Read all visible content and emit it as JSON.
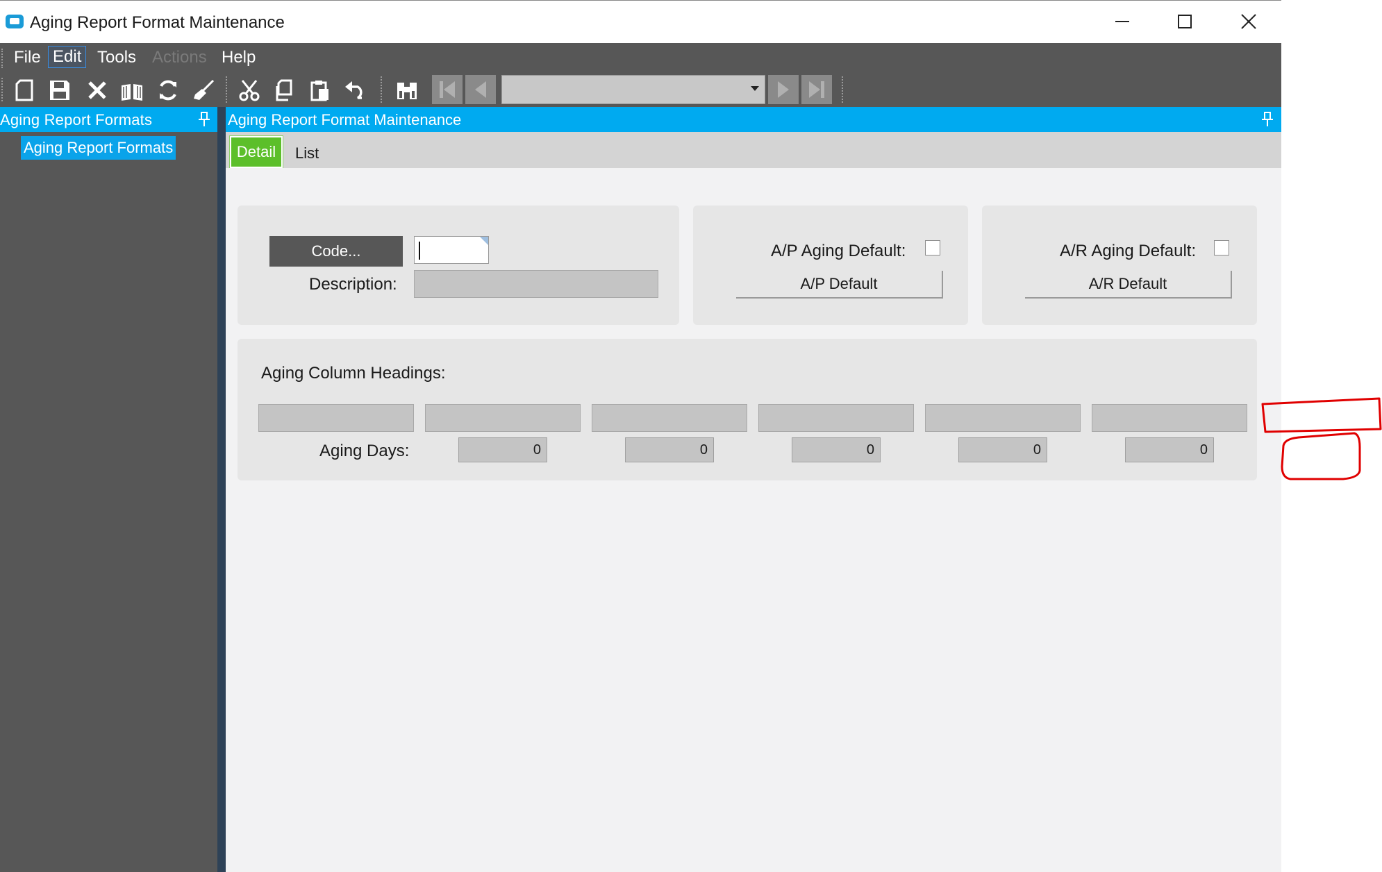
{
  "window": {
    "title": "Aging Report Format Maintenance",
    "controls": [
      "minimize",
      "maximize",
      "close"
    ]
  },
  "menubar": {
    "items": [
      {
        "label": "File",
        "enabled": true
      },
      {
        "label": "Edit",
        "enabled": true,
        "focused": true
      },
      {
        "label": "Tools",
        "enabled": true
      },
      {
        "label": "Actions",
        "enabled": false
      },
      {
        "label": "Help",
        "enabled": true
      }
    ]
  },
  "toolbar": {
    "icons": [
      "new-icon",
      "save-icon",
      "delete-icon",
      "open-book-icon",
      "refresh-icon",
      "clear-icon",
      "cut-icon",
      "copy-icon",
      "paste-icon",
      "undo-icon",
      "find-icon",
      "first-record-icon",
      "previous-record-icon",
      "next-record-icon",
      "last-record-icon"
    ],
    "navigation_value": ""
  },
  "tree": {
    "header": "Aging Report Formats",
    "items": [
      {
        "label": "Aging Report Formats",
        "selected": true
      }
    ]
  },
  "main": {
    "header": "Aging Report Format Maintenance",
    "tabs": [
      {
        "label": "Detail",
        "active": true
      },
      {
        "label": "List",
        "active": false
      }
    ],
    "form": {
      "code_button": "Code...",
      "code_value": "",
      "description_label": "Description:",
      "description_value": "",
      "ap_aging_default_label": "A/P Aging Default:",
      "ap_aging_default_checked": false,
      "ap_default_button": "A/P Default",
      "ar_aging_default_label": "A/R Aging Default:",
      "ar_aging_default_checked": false,
      "ar_default_button": "A/R Default",
      "aging_column_headings_label": "Aging Column Headings:",
      "aging_column_headings": [
        "",
        "",
        "",
        "",
        "",
        ""
      ],
      "aging_days_label": "Aging Days:",
      "aging_days": [
        "0",
        "0",
        "0",
        "0",
        "0"
      ]
    }
  },
  "annotation": {
    "color": "#e00000",
    "shapes": [
      "rectangle",
      "rectangle"
    ]
  },
  "colors": {
    "accent": "#00aaf0",
    "active_tab": "#5cbf2a",
    "menubar": "#575757",
    "content_bg": "#f2f2f3"
  }
}
